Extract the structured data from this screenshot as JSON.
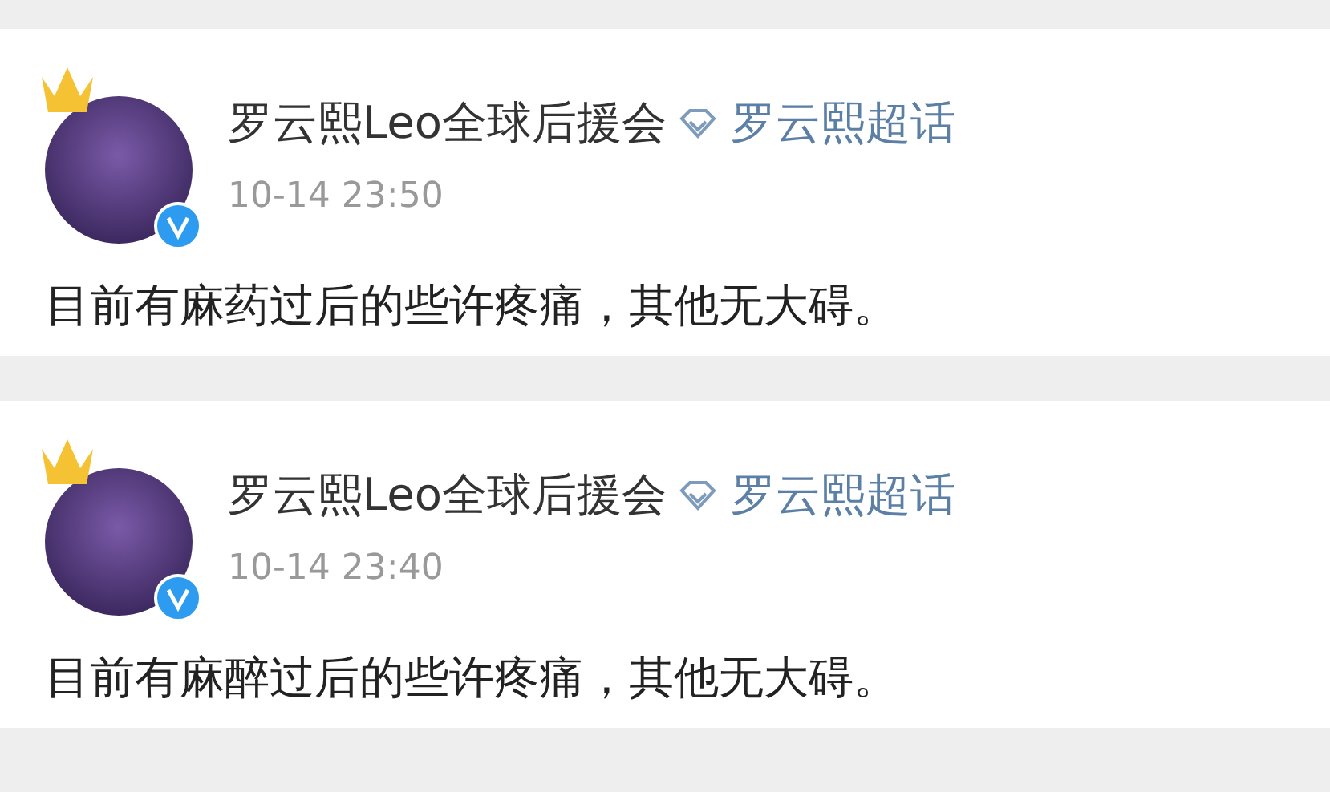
{
  "posts": [
    {
      "author": "罗云熙Leo全球后援会",
      "crown": true,
      "verified": true,
      "topic": "罗云熙超话",
      "time": "10-14 23:50",
      "text": "目前有麻药过后的些许疼痛，其他无大碍。"
    },
    {
      "author": "罗云熙Leo全球后援会",
      "crown": true,
      "verified": true,
      "topic": "罗云熙超话",
      "time": "10-14 23:40",
      "text": "目前有麻醉过后的些许疼痛，其他无大碍。"
    }
  ]
}
